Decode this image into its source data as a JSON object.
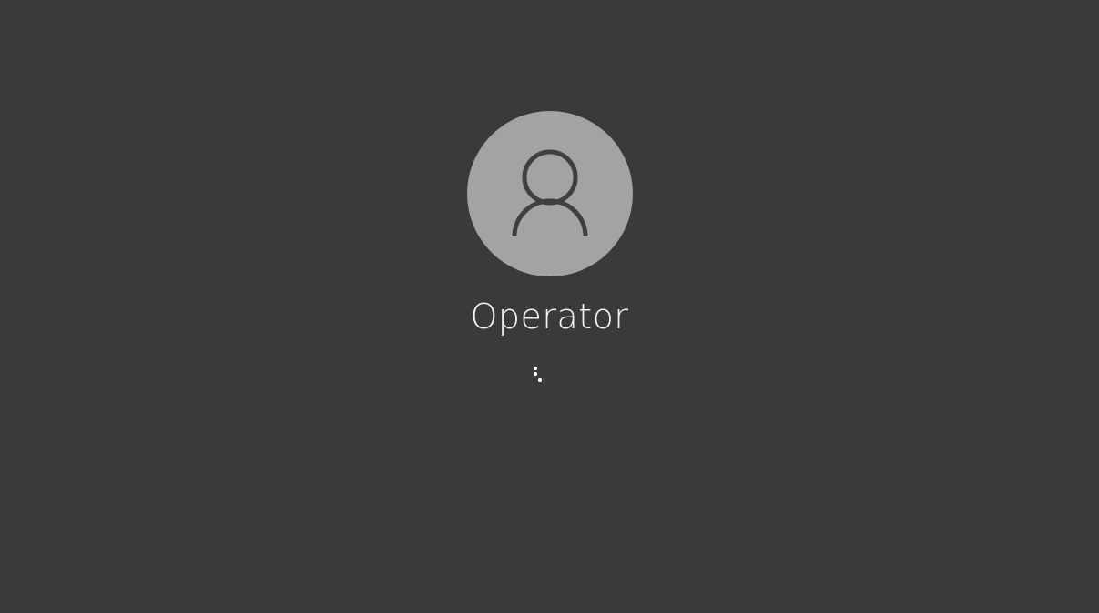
{
  "login": {
    "username": "Operator",
    "avatar_icon": "user-silhouette-icon",
    "status_indicator": "loading-spinner-icon"
  },
  "colors": {
    "background": "#3a3a3a",
    "avatar_bg": "#a3a3a3",
    "avatar_stroke": "#3f3f3f",
    "text": "#f2f2f2"
  }
}
